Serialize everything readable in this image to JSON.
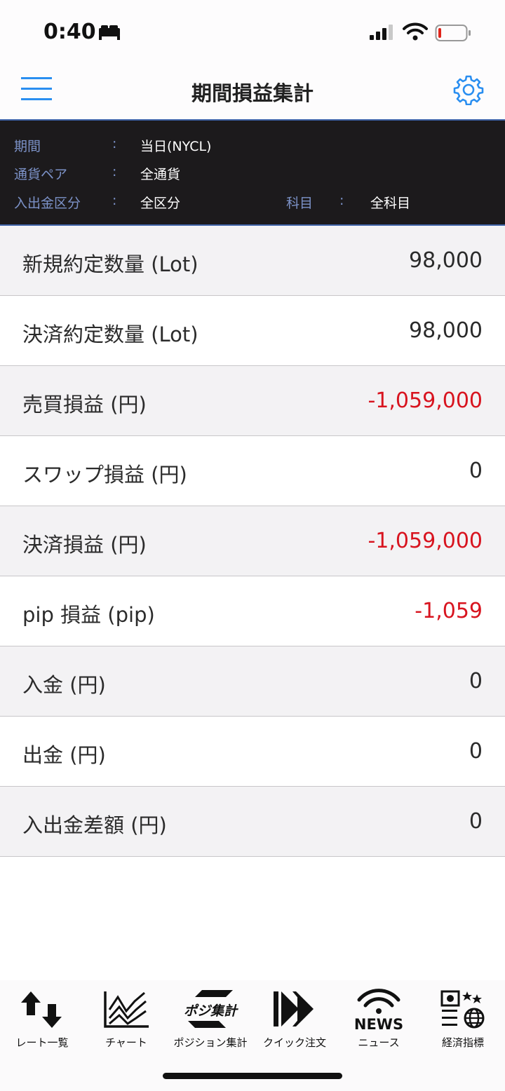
{
  "status_bar": {
    "time": "0:40",
    "icons": [
      "bed-icon",
      "cellular-signal-icon",
      "wifi-icon",
      "battery-low-icon"
    ]
  },
  "header": {
    "title": "期間損益集計",
    "menu_icon": "hamburger-menu-icon",
    "settings_icon": "gear-icon",
    "accent_color": "#2a8ef0"
  },
  "filters": {
    "colon": ":",
    "period": {
      "label": "期間",
      "value": "当日(NYCL)"
    },
    "currency_pair": {
      "label": "通貨ペア",
      "value": "全通貨"
    },
    "deposit_type": {
      "label": "入出金区分",
      "value": "全区分"
    },
    "subject": {
      "label": "科目",
      "value": "全科目"
    }
  },
  "rows": [
    {
      "label": "新規約定数量 (Lot)",
      "value": "98,000",
      "negative": false
    },
    {
      "label": "決済約定数量 (Lot)",
      "value": "98,000",
      "negative": false
    },
    {
      "label": "売買損益 (円)",
      "value": "-1,059,000",
      "negative": true
    },
    {
      "label": "スワップ損益 (円)",
      "value": "0",
      "negative": false
    },
    {
      "label": "決済損益 (円)",
      "value": "-1,059,000",
      "negative": true
    },
    {
      "label": "pip 損益 (pip)",
      "value": "-1,059",
      "negative": true
    },
    {
      "label": "入金 (円)",
      "value": "0",
      "negative": false
    },
    {
      "label": "出金 (円)",
      "value": "0",
      "negative": false
    },
    {
      "label": "入出金差額 (円)",
      "value": "0",
      "negative": false
    }
  ],
  "tabbar": {
    "tabs": [
      {
        "label": "レート一覧",
        "icon": "rate-list-arrows-icon"
      },
      {
        "label": "チャート",
        "icon": "chart-icon"
      },
      {
        "label": "ポジション集計",
        "icon": "position-summary-icon",
        "icon_text": "ポジ集計"
      },
      {
        "label": "クイック注文",
        "icon": "quick-order-icon"
      },
      {
        "label": "ニュース",
        "icon": "news-icon",
        "icon_text": "NEWS"
      },
      {
        "label": "経済指標",
        "icon": "economic-indicators-icon"
      }
    ]
  },
  "colors": {
    "negative": "#d8141f",
    "panel_background": "#1c1a1c",
    "panel_label": "#7c92c8",
    "row_alt": "#f3f2f4"
  }
}
